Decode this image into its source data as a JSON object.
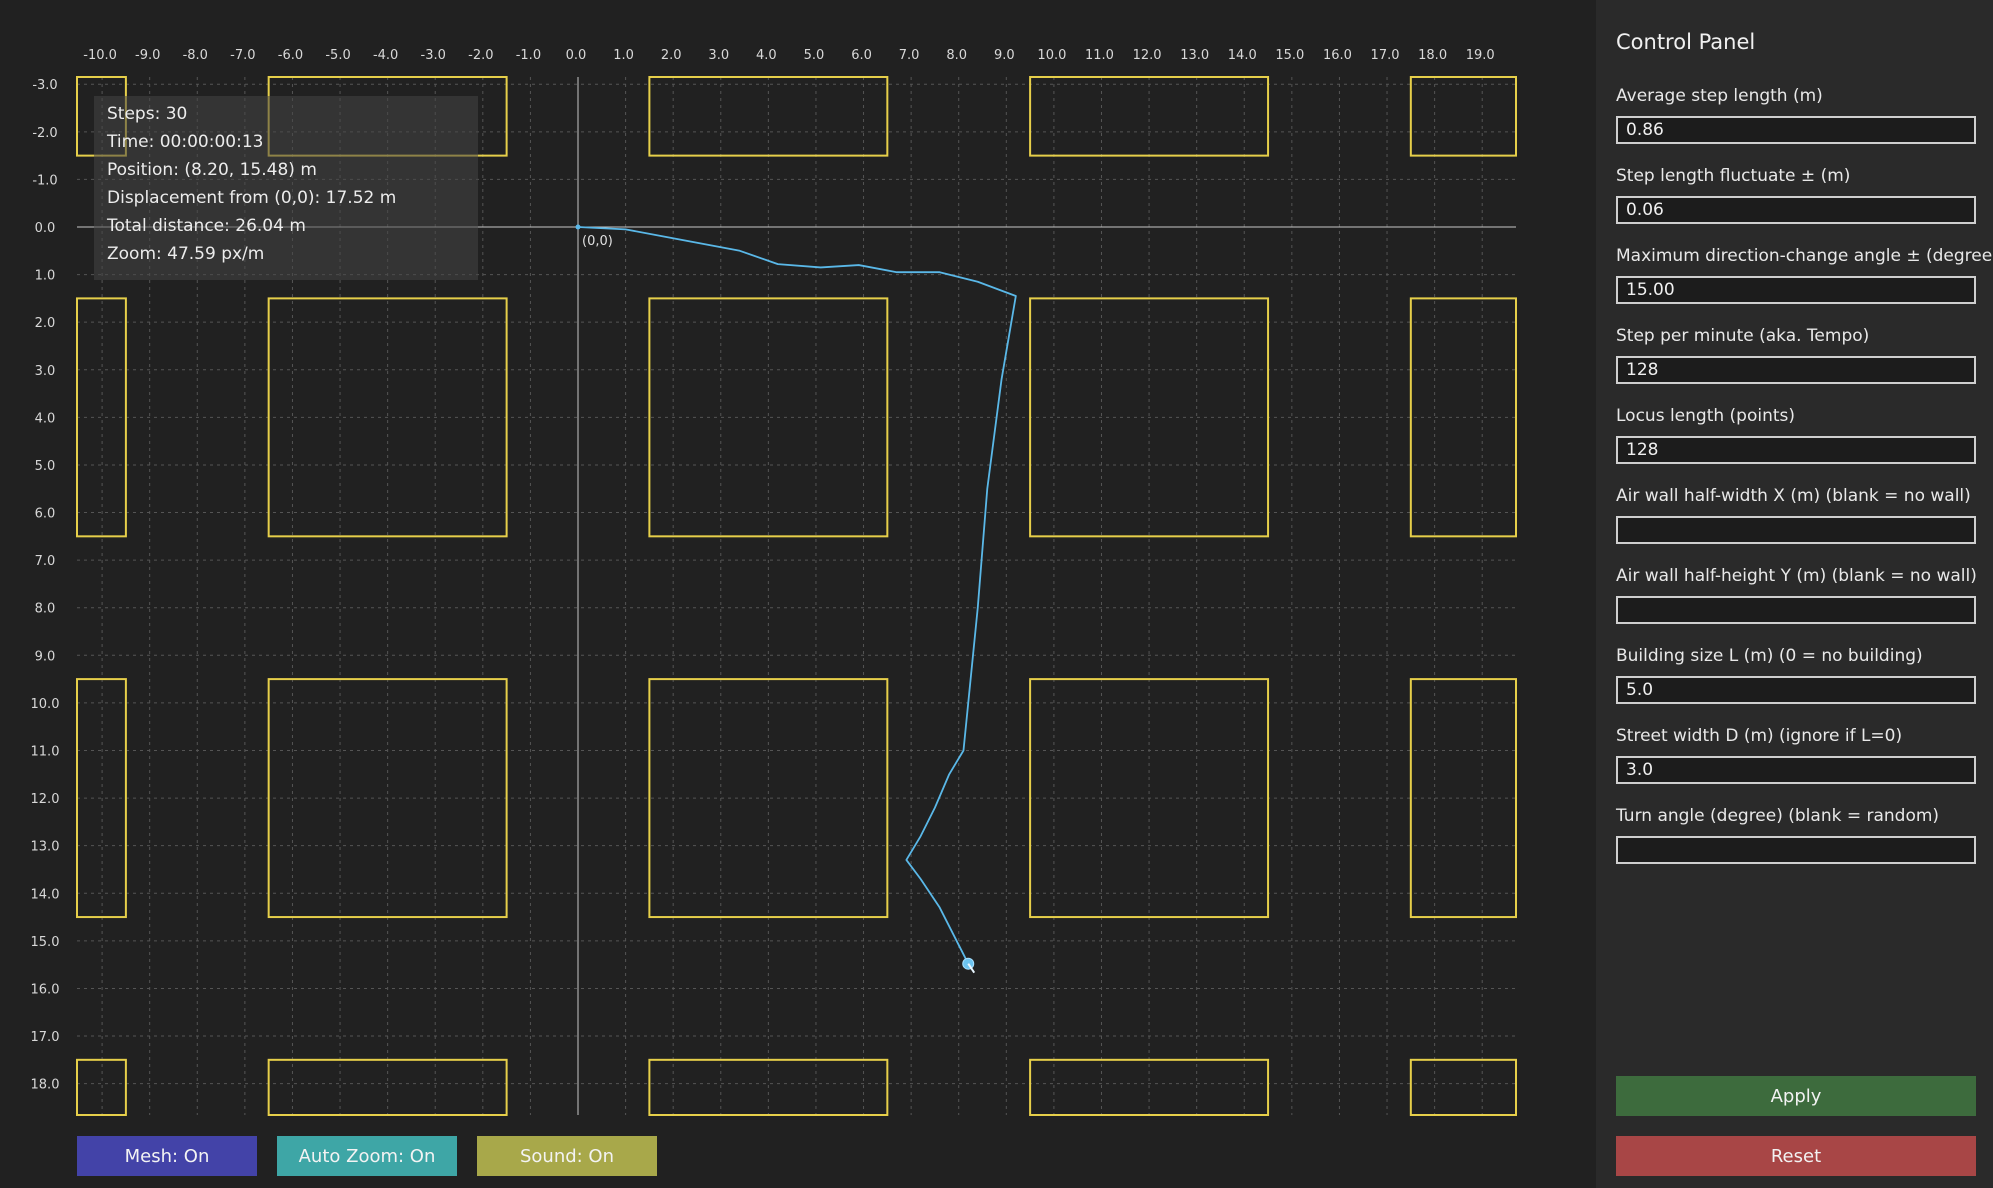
{
  "visualization": {
    "origin_label": "(0,0)",
    "x_ticks": [
      "-10.0",
      "-9.0",
      "-8.0",
      "-7.0",
      "-6.0",
      "-5.0",
      "-4.0",
      "-3.0",
      "-2.0",
      "-1.0",
      "0.0",
      "1.0",
      "2.0",
      "3.0",
      "4.0",
      "5.0",
      "6.0",
      "7.0",
      "8.0",
      "9.0",
      "10.0",
      "11.0",
      "12.0",
      "13.0",
      "14.0",
      "15.0",
      "16.0",
      "17.0",
      "18.0",
      "19.0"
    ],
    "y_ticks": [
      "-3.0",
      "-2.0",
      "-1.0",
      "0.0",
      "1.0",
      "2.0",
      "3.0",
      "4.0",
      "5.0",
      "6.0",
      "7.0",
      "8.0",
      "9.0",
      "10.0",
      "11.0",
      "12.0",
      "13.0",
      "14.0",
      "15.0",
      "16.0",
      "17.0",
      "18.0"
    ],
    "x_range": [
      -10.5,
      19.6
    ],
    "y_range": [
      -3.1,
      18.6
    ],
    "mesh": true,
    "building_size_m": 5.0,
    "street_width_m": 3.0,
    "colors": {
      "background": "#212121",
      "grid": "#555555",
      "axes": "#c8c8c8",
      "buildings": "#e6cf4a",
      "path": "#5ab8e8",
      "marker": "#6cc4f0"
    },
    "path_points": [
      [
        0,
        0
      ],
      [
        1,
        0.05
      ],
      [
        1.8,
        0.2
      ],
      [
        3.4,
        0.5
      ],
      [
        4.2,
        0.78
      ],
      [
        5.1,
        0.85
      ],
      [
        5.9,
        0.8
      ],
      [
        6.7,
        0.95
      ],
      [
        7.6,
        0.95
      ],
      [
        8.4,
        1.15
      ],
      [
        9.2,
        1.45
      ],
      [
        8.9,
        3.2
      ],
      [
        8.6,
        5.5
      ],
      [
        8.4,
        8
      ],
      [
        8.2,
        10
      ],
      [
        8.1,
        11
      ],
      [
        7.8,
        11.5
      ],
      [
        7.5,
        12.2
      ],
      [
        7.2,
        12.8
      ],
      [
        6.9,
        13.3
      ],
      [
        7.2,
        13.7
      ],
      [
        7.6,
        14.3
      ],
      [
        8.2,
        15.48
      ]
    ]
  },
  "info": {
    "steps": "Steps: 30",
    "time": "Time: 00:00:00:13",
    "position": "Position: (8.20, 15.48) m",
    "displacement": "Displacement from (0,0): 17.52 m",
    "total_distance": "Total distance: 26.04 m",
    "zoom": "Zoom: 47.59 px/m"
  },
  "toolbar": {
    "mesh_label": "Mesh: On",
    "auto_zoom_label": "Auto Zoom: On",
    "sound_label": "Sound: On",
    "mesh_color": "#4343a8",
    "auto_zoom_color": "#3ea6a6",
    "sound_color": "#a8a84a"
  },
  "panel": {
    "title": "Control Panel",
    "fields": [
      {
        "label": "Average step length (m)",
        "value": "0.86"
      },
      {
        "label": "Step length fluctuate ± (m)",
        "value": "0.06"
      },
      {
        "label": "Maximum direction-change angle ± (degree)",
        "value": "15.00"
      },
      {
        "label": "Step per minute (aka. Tempo)",
        "value": "128"
      },
      {
        "label": "Locus length (points)",
        "value": "128"
      },
      {
        "label": "Air wall half-width X (m) (blank = no wall)",
        "value": ""
      },
      {
        "label": "Air wall half-height Y (m) (blank = no wall)",
        "value": ""
      },
      {
        "label": "Building size L (m) (0 = no building)",
        "value": "5.0"
      },
      {
        "label": "Street width D (m) (ignore if L=0)",
        "value": "3.0"
      },
      {
        "label": "Turn angle (degree) (blank = random)",
        "value": ""
      }
    ],
    "apply_label": "Apply",
    "reset_label": "Reset",
    "apply_color": "#3d6b3d",
    "reset_color": "#a84646"
  }
}
